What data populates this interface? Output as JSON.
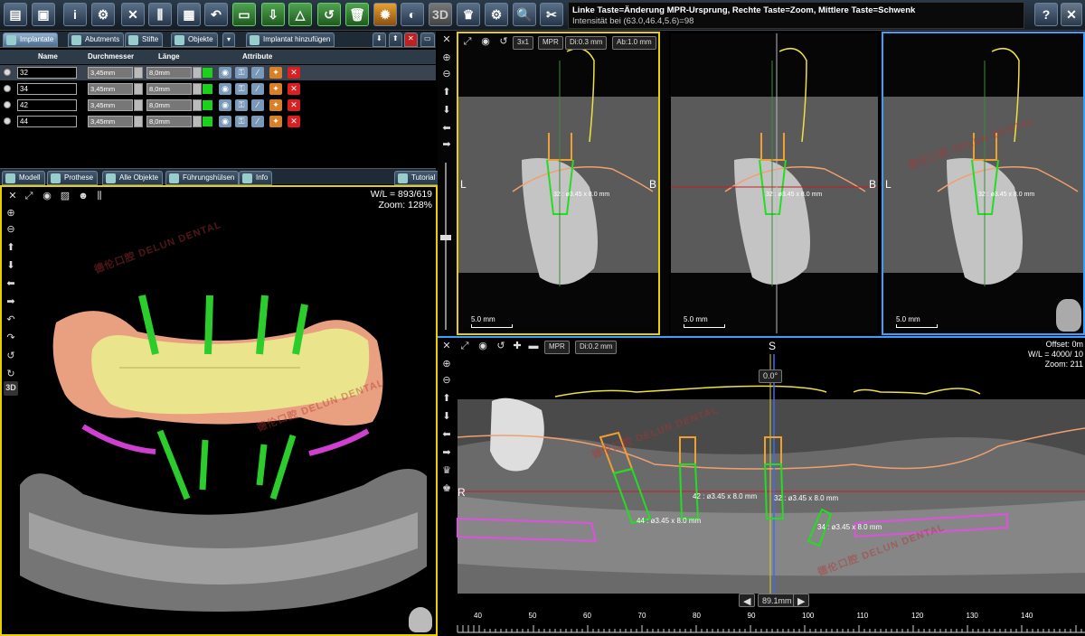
{
  "toolbar": {
    "buttons": [
      "save-icon",
      "undo-icon",
      "gear-icon",
      "tools-icon",
      "implant-icon",
      "document-icon",
      "undo-arrow-icon",
      "ruler-icon",
      "export-icon",
      "measure-icon",
      "sleeve-icon",
      "trash-icon",
      "xray-icon",
      "contrast-icon",
      "3d-label",
      "crown-icon",
      "settings-icon",
      "search-icon",
      "cut-icon"
    ],
    "label_3d": "3D",
    "help": "?",
    "hint_line1": "Linke Taste=Änderung MPR-Ursprung, Rechte Taste=Zoom, Mittlere Taste=Schwenk",
    "hint_line2": "Intensität bei (63.0,46.4,5.6)=98"
  },
  "tabs": {
    "implantate": "Implantate",
    "abutments": "Abutments",
    "stifte": "Stifte",
    "objekte": "Objekte",
    "add": "Implantat hinzufügen"
  },
  "table": {
    "headers": {
      "name": "Name",
      "durchmesser": "Durchmesser",
      "laenge": "Länge",
      "attribute": "Attribute"
    },
    "rows": [
      {
        "name": "32",
        "diameter": "3,45mm",
        "length": "8,0mm",
        "selected": true
      },
      {
        "name": "34",
        "diameter": "3,45mm",
        "length": "8,0mm",
        "selected": false
      },
      {
        "name": "42",
        "diameter": "3,45mm",
        "length": "8,0mm",
        "selected": false
      },
      {
        "name": "44",
        "diameter": "3,45mm",
        "length": "8,0mm",
        "selected": false
      }
    ]
  },
  "bottom_tabs": {
    "modell": "Modell",
    "prothese": "Prothese",
    "alle": "Alle Objekte",
    "fuehrung": "Führungshülsen",
    "info": "Info",
    "tutorial": "Tutorial"
  },
  "view3d": {
    "wl": "W/L = 893/619",
    "zoom": "Zoom: 128%",
    "label_3d": "3D"
  },
  "mpr_top": {
    "layout": "3x1",
    "mpr": "MPR",
    "di": "Di:0.3 mm",
    "ab": "Ab:1.0 mm",
    "panels": [
      {
        "left": "L",
        "right": "B",
        "implant_label": "32 : ø3.45 x 8.0 mm",
        "scale": "5.0 mm"
      },
      {
        "left": "",
        "right": "B",
        "implant_label": "32 : ø3.45 x 8.0 mm",
        "scale": "5.0 mm"
      },
      {
        "left": "L",
        "right": "",
        "implant_label": "32 : ø3.45 x 8.0 mm",
        "scale": "5.0 mm"
      }
    ]
  },
  "panoramic": {
    "mpr": "MPR",
    "di": "Di:0.2 mm",
    "orient_top": "S",
    "orient_left": "R",
    "angle": "0.0°",
    "offset": "Offset: 0m",
    "wl": "W/L = 4000/ 10",
    "zoom": "Zoom: 211",
    "position": "89.1mm",
    "implant_labels": [
      "44 : ø3.45 x 8.0 mm",
      "42 : ø3.45 x 8.0 mm",
      "32 : ø3.45 x 8.0 mm",
      "34 : ø3.45 x 8.0 mm"
    ],
    "ruler_ticks": [
      "40",
      "50",
      "60",
      "70",
      "80",
      "90",
      "100",
      "110",
      "120",
      "130",
      "140"
    ]
  },
  "watermark": {
    "cn": "德伦口腔",
    "en": "DELUN DENTAL"
  },
  "colors": {
    "accent": "#f0d000",
    "implant": "#22dd22",
    "sleeve": "#f0a030",
    "selected_border": "#3aa0ff"
  }
}
